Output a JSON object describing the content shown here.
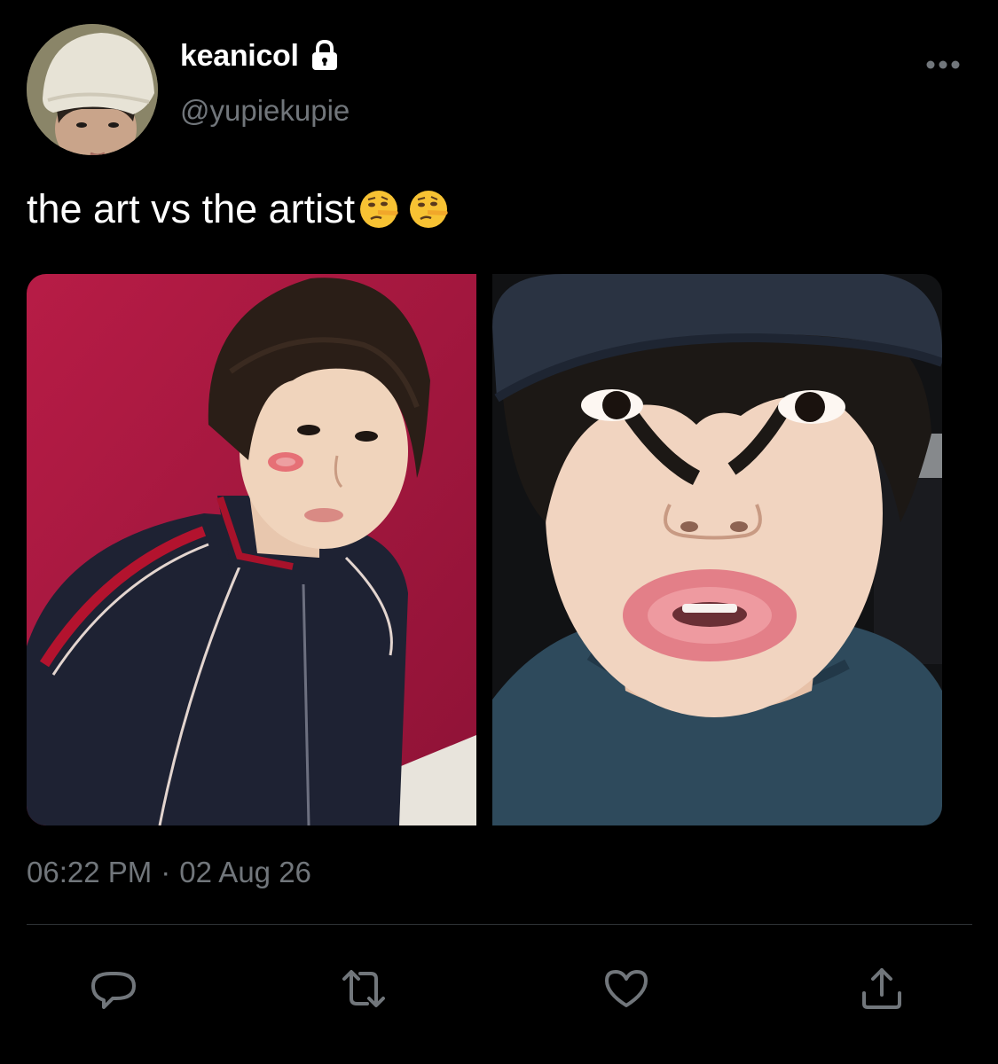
{
  "user": {
    "display_name": "keanicol",
    "handle": "@yupiekupie",
    "protected_icon": "lock-icon",
    "avatar_icon": "profile-photo"
  },
  "tweet": {
    "text": "the art vs the artist",
    "emojis": [
      "face-with-rolling-eyes-lying-face-emoji",
      "face-with-rolling-eyes-lying-face-emoji"
    ],
    "media": [
      {
        "name": "photo-left",
        "description_icon": "selfie-photo"
      },
      {
        "name": "photo-right",
        "description_icon": "selfie-photo"
      }
    ],
    "time": "06:22 PM",
    "separator": "·",
    "date": "02 Aug 26"
  },
  "actions": {
    "reply_icon": "reply-icon",
    "retweet_icon": "retweet-icon",
    "like_icon": "heart-icon",
    "share_icon": "share-icon"
  },
  "colors": {
    "background": "#000000",
    "text_primary": "#ffffff",
    "text_secondary": "#71767b",
    "divider": "#2f3336",
    "left_photo_backdrop": "#a3173e",
    "right_photo_shirt": "#2e4a5c"
  }
}
